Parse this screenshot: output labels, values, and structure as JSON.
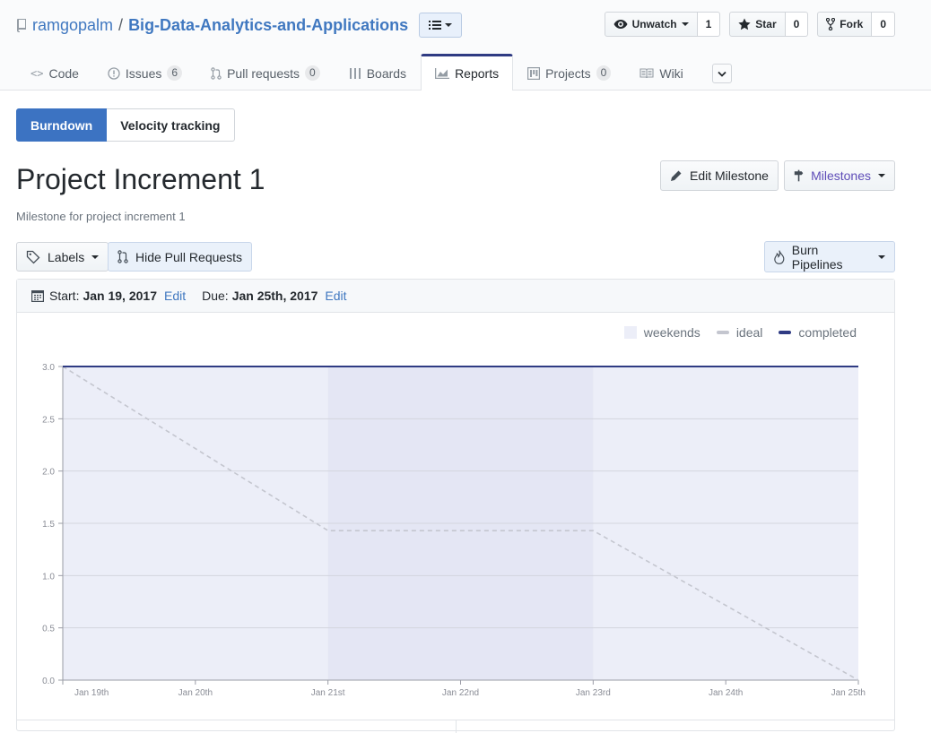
{
  "repo": {
    "owner": "ramgopalm",
    "separator": "/",
    "name": "Big-Data-Analytics-and-Applications"
  },
  "actions": [
    {
      "label": "Unwatch",
      "count": "1",
      "icon": "eye-icon"
    },
    {
      "label": "Star",
      "count": "0",
      "icon": "star-icon"
    },
    {
      "label": "Fork",
      "count": "0",
      "icon": "fork-icon"
    }
  ],
  "nav": [
    {
      "label": "Code",
      "icon": "code-icon"
    },
    {
      "label": "Issues",
      "count": "6",
      "icon": "issue-icon"
    },
    {
      "label": "Pull requests",
      "count": "0",
      "icon": "pull-request-icon"
    },
    {
      "label": "Boards",
      "icon": "boards-icon"
    },
    {
      "label": "Reports",
      "icon": "graph-icon",
      "selected": true
    },
    {
      "label": "Projects",
      "count": "0",
      "icon": "project-icon"
    },
    {
      "label": "Wiki",
      "icon": "book-icon"
    }
  ],
  "report_tabs": {
    "burndown": "Burndown",
    "velocity": "Velocity tracking"
  },
  "milestone": {
    "title": "Project Increment 1",
    "description": "Milestone for project increment 1",
    "edit_label": "Edit Milestone",
    "milestones_label": "Milestones"
  },
  "filters": {
    "labels": "Labels",
    "hide_prs": "Hide Pull Requests",
    "burn_pipelines": "Burn Pipelines"
  },
  "dates": {
    "start_label": "Start:",
    "start_value": "Jan 19, 2017",
    "due_label": "Due:",
    "due_value": "Jan 25th, 2017",
    "edit": "Edit"
  },
  "colors": {
    "accent": "#3c73c2",
    "completed": "#2f3b83",
    "ideal": "#c4c6cf",
    "weekend": "#e4e6f4",
    "plot_bg": "#eceef8"
  },
  "chart_data": {
    "type": "line",
    "x": [
      "Jan 19th",
      "Jan 20th",
      "Jan 21st",
      "Jan 22nd",
      "Jan 23rd",
      "Jan 24th",
      "Jan 25th"
    ],
    "ylim": [
      0,
      3
    ],
    "yticks": [
      "0.0",
      "0.5",
      "1.0",
      "1.5",
      "2.0",
      "2.5",
      "3.0"
    ],
    "weekends": [
      [
        "Jan 21st",
        "Jan 23rd"
      ]
    ],
    "series": [
      {
        "name": "ideal",
        "style": "dashed",
        "points": [
          [
            "Jan 19th",
            3.0
          ],
          [
            "Jan 21st",
            1.43
          ],
          [
            "Jan 23rd",
            1.43
          ],
          [
            "Jan 25th",
            0.0
          ]
        ]
      },
      {
        "name": "completed",
        "style": "solid",
        "points": [
          [
            "Jan 19th",
            3.0
          ],
          [
            "Jan 25th",
            3.0
          ]
        ]
      }
    ],
    "legend": [
      "weekends",
      "ideal",
      "completed"
    ],
    "legend_position": "top-right"
  }
}
